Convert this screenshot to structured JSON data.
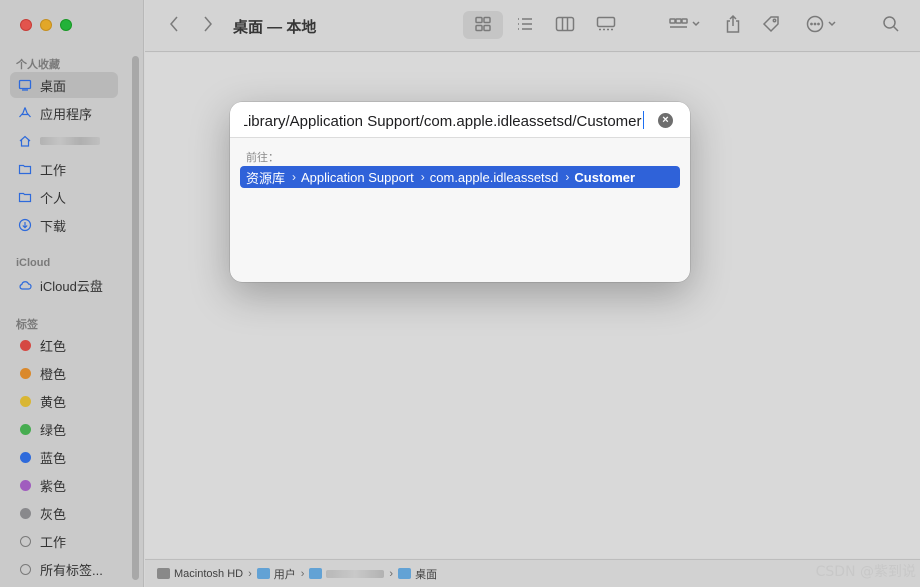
{
  "window": {
    "title": "桌面 — 本地"
  },
  "sidebar": {
    "favorites_header": "个人收藏",
    "favorites": [
      {
        "label": "桌面",
        "icon": "desktop-icon",
        "active": true
      },
      {
        "label": "应用程序",
        "icon": "apps-icon",
        "active": false
      },
      {
        "label": "",
        "icon": "home-icon",
        "active": false,
        "blurred": true
      },
      {
        "label": "工作",
        "icon": "folder-icon",
        "active": false
      },
      {
        "label": "个人",
        "icon": "folder-icon",
        "active": false
      },
      {
        "label": "下载",
        "icon": "download-icon",
        "active": false
      }
    ],
    "icloud_header": "iCloud",
    "icloud": [
      {
        "label": "iCloud云盘",
        "icon": "cloud-icon"
      }
    ],
    "tags_header": "标签",
    "tags": [
      {
        "label": "红色",
        "color": "#f0524b"
      },
      {
        "label": "橙色",
        "color": "#f59a32"
      },
      {
        "label": "黄色",
        "color": "#f4cd3a"
      },
      {
        "label": "绿色",
        "color": "#4fc25a"
      },
      {
        "label": "蓝色",
        "color": "#3478f6"
      },
      {
        "label": "紫色",
        "color": "#b468d6"
      },
      {
        "label": "灰色",
        "color": "#9a9a9e"
      },
      {
        "label": "工作",
        "color": "outline"
      },
      {
        "label": "所有标签...",
        "color": "outline"
      }
    ]
  },
  "goto_dialog": {
    "input_value": "Library/Application Support/com.apple.idleassetsd/Customer",
    "goto_label": "前往：",
    "suggestion": {
      "segments": [
        "资源库",
        "Application Support",
        "com.apple.idleassetsd"
      ],
      "last": "Customer"
    }
  },
  "pathbar": {
    "items": [
      "Macintosh HD",
      "用户",
      "",
      "桌面"
    ]
  },
  "watermark": "CSDN @紫到说"
}
